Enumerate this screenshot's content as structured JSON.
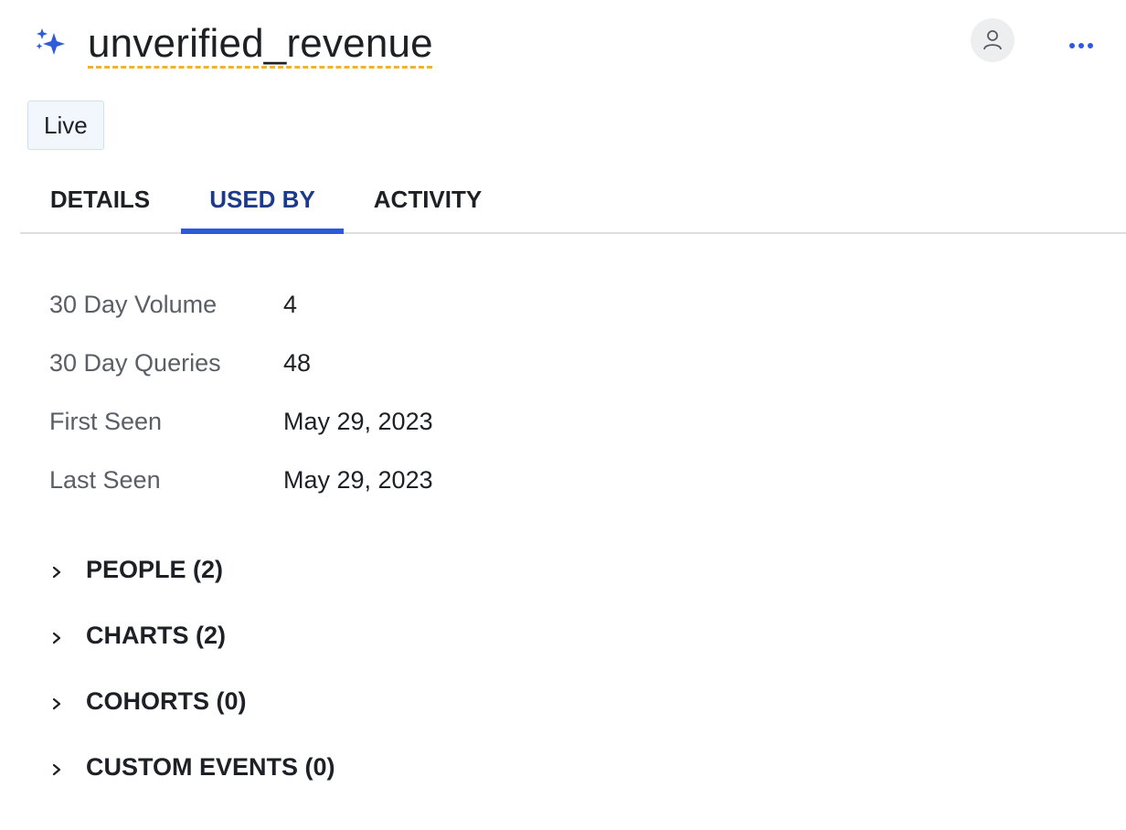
{
  "header": {
    "title": "unverified_revenue",
    "icon": "sparkle-icon",
    "accent_color": "#2f5bd8",
    "underline_color": "#f0b429"
  },
  "status_badge": "Live",
  "tabs": [
    {
      "label": "DETAILS",
      "active": false
    },
    {
      "label": "USED BY",
      "active": true
    },
    {
      "label": "ACTIVITY",
      "active": false
    }
  ],
  "stats": [
    {
      "label": "30 Day Volume",
      "value": "4"
    },
    {
      "label": "30 Day Queries",
      "value": "48"
    },
    {
      "label": "First Seen",
      "value": "May 29, 2023"
    },
    {
      "label": "Last Seen",
      "value": "May 29, 2023"
    }
  ],
  "sections": [
    {
      "label": "PEOPLE (2)",
      "expanded": false
    },
    {
      "label": "CHARTS (2)",
      "expanded": false
    },
    {
      "label": "COHORTS (0)",
      "expanded": false
    },
    {
      "label": "CUSTOM EVENTS (0)",
      "expanded": false
    }
  ]
}
